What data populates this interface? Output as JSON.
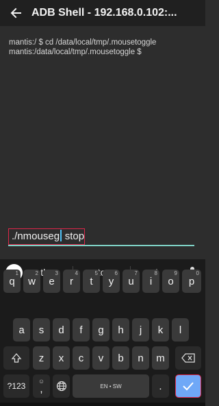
{
  "appbar": {
    "title": "ADB Shell - 192.168.0.102:..."
  },
  "terminal": {
    "lines": [
      "mantis:/ $ cd /data/local/tmp/.mousetoggle",
      "mantis:/data/local/tmp/.mousetoggle $"
    ]
  },
  "input": {
    "before_cursor": "./nmouseg",
    "after_cursor": " stop"
  },
  "suggestions": [
    "the",
    "stop",
    "I"
  ],
  "keyboard": {
    "row1": [
      {
        "k": "q",
        "n": "1"
      },
      {
        "k": "w",
        "n": "2"
      },
      {
        "k": "e",
        "n": "3"
      },
      {
        "k": "r",
        "n": "4"
      },
      {
        "k": "t",
        "n": "5"
      },
      {
        "k": "y",
        "n": "6"
      },
      {
        "k": "u",
        "n": "7"
      },
      {
        "k": "i",
        "n": "8"
      },
      {
        "k": "o",
        "n": "9"
      },
      {
        "k": "p",
        "n": "0"
      }
    ],
    "row2": [
      "a",
      "s",
      "d",
      "f",
      "g",
      "h",
      "j",
      "k",
      "l"
    ],
    "row3": [
      "z",
      "x",
      "c",
      "v",
      "b",
      "n",
      "m"
    ],
    "sym_label": "?123",
    "comma_label": ",",
    "comma_emoji": "☺",
    "space_label": "EN • SW",
    "period_label": "."
  }
}
